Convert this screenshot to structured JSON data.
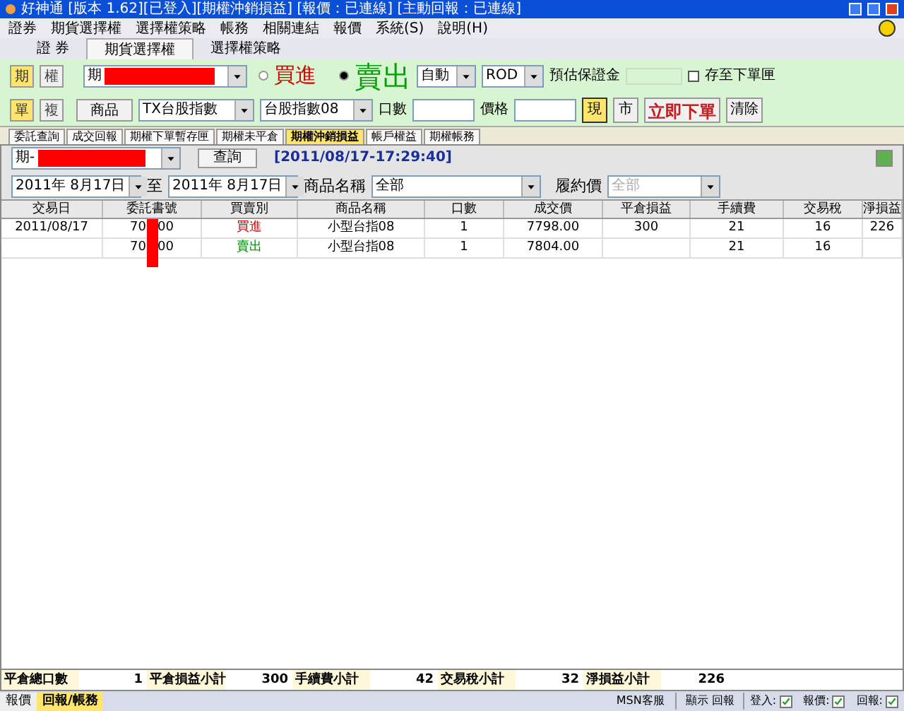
{
  "window": {
    "title": "好神通 [版本 1.62][已登入][期權沖銷損益] [報價：已連線] [主動回報：已連線]"
  },
  "menu": [
    "證券",
    "期貨選擇權",
    "選擇權策略",
    "帳務",
    "相關連結",
    "報價",
    "系統(S)",
    "說明(H)"
  ],
  "tabs": [
    {
      "label": "證 券",
      "selected": false
    },
    {
      "label": "期貨選擇權",
      "selected": true
    },
    {
      "label": "選擇權策略",
      "selected": false
    }
  ],
  "order": {
    "mode_buttons": [
      {
        "label": "期",
        "selected": true
      },
      {
        "label": "權",
        "selected": false
      }
    ],
    "lot_buttons": [
      {
        "label": "單",
        "selected": true
      },
      {
        "label": "複",
        "selected": false
      }
    ],
    "account": "期",
    "buy": {
      "label": "買進",
      "selected": false
    },
    "sell": {
      "label": "賣出",
      "selected": true
    },
    "auto": "自動",
    "rod": "ROD",
    "margin_label": "預估保證金",
    "save_label": "存至下單匣",
    "save_checked": false,
    "product_button": "商品",
    "product": "TX台股指數",
    "contract": "台股指數08",
    "qty_label": "口數",
    "price_label": "價格",
    "spot": {
      "label": "現",
      "selected": true
    },
    "market": "市",
    "submit": "立即下單",
    "clear": "清除"
  },
  "subtabs": [
    {
      "label": "委託查詢",
      "selected": false
    },
    {
      "label": "成交回報",
      "selected": false
    },
    {
      "label": "期權下單暫存匣",
      "selected": false
    },
    {
      "label": "期權未平倉",
      "selected": false
    },
    {
      "label": "期權沖銷損益",
      "selected": true
    },
    {
      "label": "帳戶權益",
      "selected": false
    },
    {
      "label": "期權帳務",
      "selected": false
    }
  ],
  "query": {
    "account": "期-",
    "button": "查詢",
    "timestamp": "[2011/08/17-17:29:40]",
    "from": "2011年 8月17日",
    "to_label": "至",
    "to": "2011年 8月17日",
    "product_label": "商品名稱",
    "product": "全部",
    "strike_label": "履約價",
    "strike": "全部"
  },
  "table": {
    "columns": [
      "交易日",
      "委託書號",
      "買賣別",
      "商品名稱",
      "口數",
      "成交價",
      "平倉損益",
      "手續費",
      "交易稅",
      "淨損益"
    ],
    "rows": [
      {
        "date": "2011/08/17",
        "order_prefix": "70",
        "order_suffix": "00",
        "side": "買進",
        "color": "#c00000",
        "product": "小型台指08",
        "qty": "1",
        "price": "7798.00",
        "pl": "300",
        "fee": "21",
        "tax": "16",
        "net": "226"
      },
      {
        "date": "",
        "order_prefix": "70",
        "order_suffix": "00",
        "side": "賣出",
        "color": "#008000",
        "product": "小型台指08",
        "qty": "1",
        "price": "7804.00",
        "pl": "",
        "fee": "21",
        "tax": "16",
        "net": ""
      }
    ]
  },
  "summary": [
    {
      "label": "平倉總口數",
      "value": "1"
    },
    {
      "label": "平倉損益小計",
      "value": "300"
    },
    {
      "label": "手續費小計",
      "value": "42"
    },
    {
      "label": "交易稅小計",
      "value": "32"
    },
    {
      "label": "淨損益小計",
      "value": "226"
    }
  ],
  "bottom_tabs": [
    {
      "label": "報價",
      "selected": false
    },
    {
      "label": "回報/帳務",
      "selected": true
    }
  ],
  "status": {
    "msn": "MSN客服",
    "show": "顯示 回報",
    "indicators": [
      {
        "label": "登入:",
        "checked": true
      },
      {
        "label": "報價:",
        "checked": true
      },
      {
        "label": "回報:",
        "checked": true
      }
    ]
  }
}
